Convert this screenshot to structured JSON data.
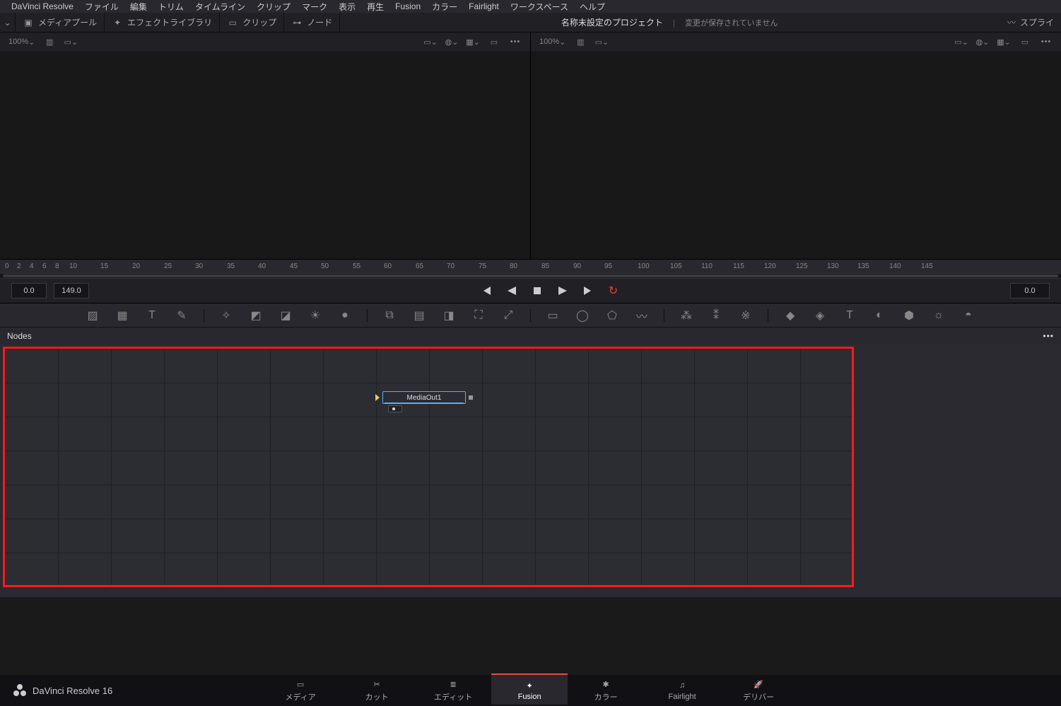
{
  "menu": [
    "DaVinci Resolve",
    "ファイル",
    "編集",
    "トリム",
    "タイムライン",
    "クリップ",
    "マーク",
    "表示",
    "再生",
    "Fusion",
    "カラー",
    "Fairlight",
    "ワークスペース",
    "ヘルプ"
  ],
  "toolbar2": {
    "media_pool": "メディアプール",
    "effect_lib": "エフェクトライブラリ",
    "clips": "クリップ",
    "nodes": "ノード",
    "spline": "スプライ"
  },
  "project": {
    "title": "名称未設定のプロジェクト",
    "save": "変更が保存されていません"
  },
  "viewer": {
    "zoom_left": "100%",
    "zoom_right": "100%"
  },
  "ruler_ticks": [
    "0",
    "2",
    "4",
    "6",
    "8",
    "10",
    "15",
    "20",
    "25",
    "30",
    "35",
    "40",
    "45",
    "50",
    "55",
    "60",
    "65",
    "70",
    "75",
    "80",
    "85",
    "90",
    "95",
    "100",
    "105",
    "110",
    "115",
    "120",
    "125",
    "130",
    "135",
    "140",
    "145"
  ],
  "play": {
    "start": "0.0",
    "end": "149.0",
    "current": "0.0"
  },
  "nodes_label": "Nodes",
  "node_name": "MediaOut1",
  "footer": {
    "app": "DaVinci Resolve 16",
    "tabs": [
      {
        "id": "media",
        "label": "メディア"
      },
      {
        "id": "cut",
        "label": "カット"
      },
      {
        "id": "edit",
        "label": "エディット"
      },
      {
        "id": "fusion",
        "label": "Fusion",
        "active": true
      },
      {
        "id": "color",
        "label": "カラー"
      },
      {
        "id": "fairlight",
        "label": "Fairlight"
      },
      {
        "id": "deliver",
        "label": "デリバー"
      }
    ]
  }
}
